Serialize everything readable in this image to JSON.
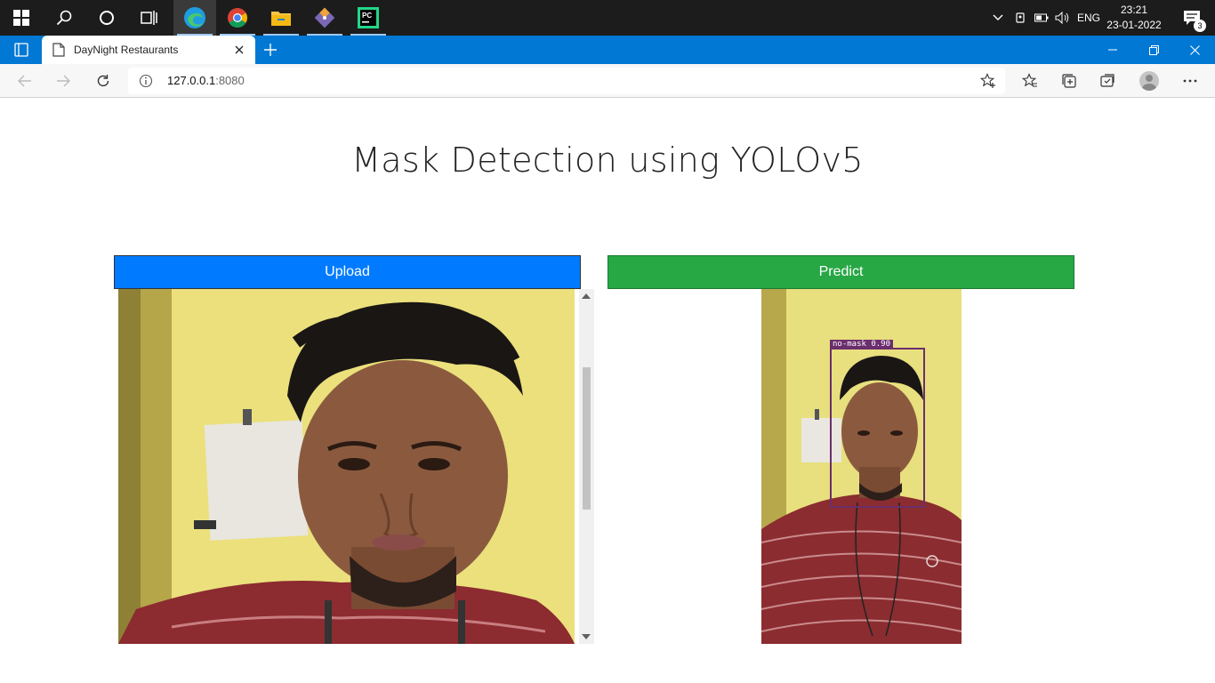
{
  "taskbar": {
    "icons": [
      "windows-start-icon",
      "search-icon",
      "cortana-icon",
      "task-view-icon",
      "edge-icon",
      "chrome-icon",
      "file-explorer-icon",
      "git-icon",
      "pycharm-icon"
    ],
    "language": "ENG",
    "time": "23:21",
    "date": "23-01-2022",
    "notifications": "3"
  },
  "browser": {
    "tab_title": "DayNight Restaurants",
    "url_host": "127.0.0.1",
    "url_port": ":8080"
  },
  "page": {
    "title": "Mask Detection using YOLOv5",
    "upload_label": "Upload",
    "predict_label": "Predict",
    "detection_label": "no-mask 0.90",
    "detection_confidence": 0.9
  },
  "colors": {
    "upload": "#007bff",
    "predict": "#28a745",
    "tabbar": "#0078d4",
    "detection_box": "#6b2e6d"
  }
}
